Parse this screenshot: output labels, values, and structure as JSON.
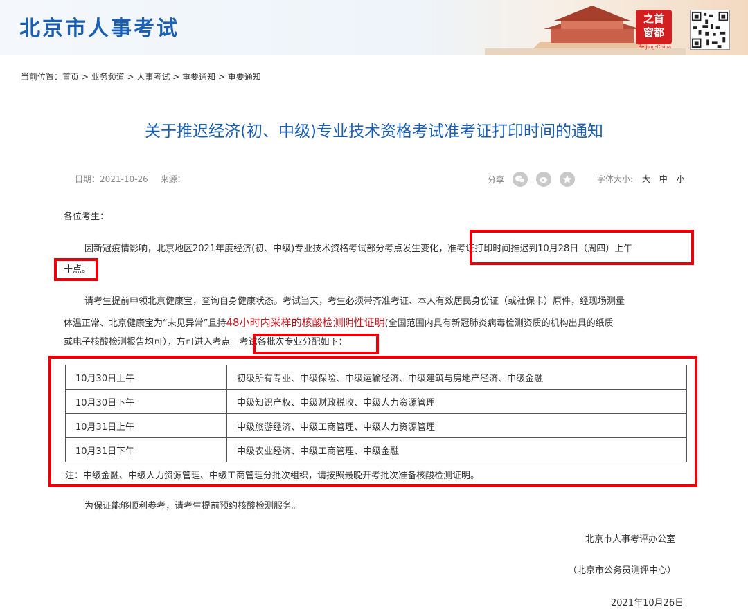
{
  "header": {
    "site_title": "北京市人事考试",
    "seal_chars": [
      "之首",
      "窗都"
    ],
    "seal_sub": "Beijing-China"
  },
  "breadcrumb": "当前位置：首页 > 业务频道 > 人事考试 > 重要通知 > 重要通知",
  "article": {
    "title": "关于推迟经济(初、中级)专业技术资格考试准考证打印时间的通知",
    "date": "日期：2021-10-26",
    "source": "来源：",
    "share_label": "分享",
    "font_size_label": "字体大小:",
    "font_sizes": [
      "大",
      "中",
      "小"
    ],
    "salutation": "各位考生：",
    "para1_a": "因新冠疫情影响，北京地区2021年度经济(初、中级)专业技术资格考试部分考点发生变化，准考证打印时间推迟到10月28日（周四）上午",
    "para1_b": "十点。",
    "para2_line1": "请考生提前申领北京健康宝，查询自身健康状态。考试当天，考生必须带齐准考证、本人有效居民身份证（或社保卡）原件，经现场测量",
    "para2_line2_a": "体温正常、北京健康宝为“未见异常”且持",
    "para2_line2_red": "48小时内采样的核酸检测阴性证明",
    "para2_line2_b": "(全国范围内具有新冠肺炎病毒检测资质的机构出具的纸质",
    "para2_line3": "或电子核酸检测报告均可），方可进入考点。考试各批次专业分配如下：",
    "schedule": [
      {
        "time": "10月30日上午",
        "majors": "初级所有专业、中级保险、中级运输经济、中级建筑与房地产经济、中级金融"
      },
      {
        "time": "10月30日下午",
        "majors": "中级知识产权、中级财政税收、中级人力资源管理"
      },
      {
        "time": "10月31日上午",
        "majors": "中级旅游经济、中级工商管理、中级人力资源管理"
      },
      {
        "time": "10月31日下午",
        "majors": "中级农业经济、中级工商管理、中级金融"
      }
    ],
    "note": "注：中级金融、中级人力资源管理、中级工商管理分批次组织，请按照最晚开考批次准备核酸检测证明。",
    "para3": "为保证能够顺利参考，请考生提前预约核酸检测服务。",
    "signature_org": "北京市人事考评办公室",
    "signature_sub": "（北京市公务员测评中心）",
    "signature_date": "2021年10月26日"
  },
  "colors": {
    "brand_blue": "#1a5fb4",
    "highlight_red": "#e8000b",
    "text_red": "#c3161c"
  }
}
